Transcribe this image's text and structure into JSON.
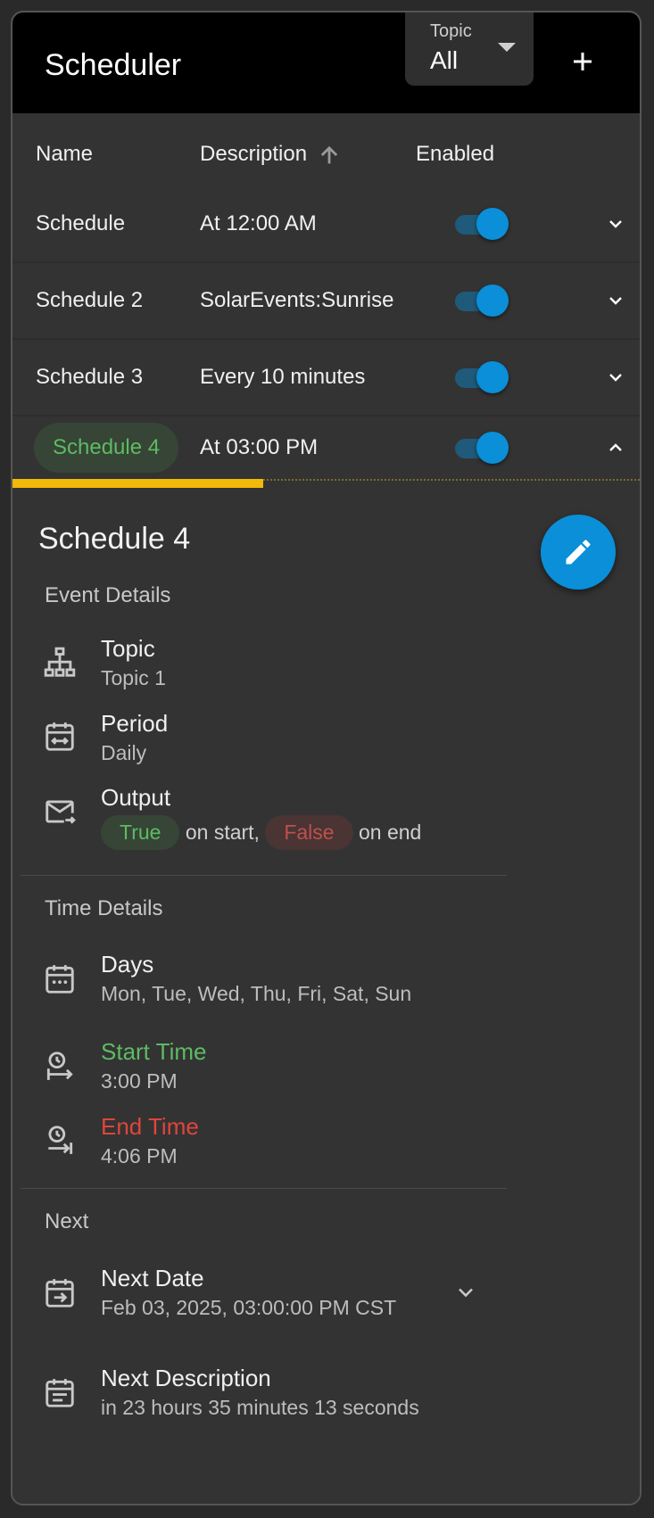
{
  "header": {
    "title": "Scheduler",
    "topic_label": "Topic",
    "topic_value": "All",
    "add_label": "+"
  },
  "table": {
    "columns": [
      "Name",
      "Description",
      "Enabled"
    ],
    "rows": [
      {
        "name": "Schedule",
        "description": "At 12:00 AM",
        "enabled": true
      },
      {
        "name": "Schedule 2",
        "description": "SolarEvents:Sunrise",
        "enabled": true
      },
      {
        "name": "Schedule 3",
        "description": "Every 10 minutes",
        "enabled": true
      },
      {
        "name": "Schedule 4",
        "description": "At 03:00 PM",
        "enabled": true
      }
    ]
  },
  "detail": {
    "title": "Schedule 4",
    "progress": 0.4,
    "event_section": "Event Details",
    "topic_label": "Topic",
    "topic_value": "Topic 1",
    "period_label": "Period",
    "period_value": "Daily",
    "output_label": "Output",
    "output_true": "True",
    "output_start": "on start,",
    "output_false": "False",
    "output_end": "on end",
    "time_section": "Time Details",
    "days_label": "Days",
    "days_value": "Mon, Tue, Wed, Thu, Fri, Sat, Sun",
    "start_label": "Start Time",
    "start_value": "3:00 PM",
    "end_label": "End Time",
    "end_value": "4:06 PM",
    "next_section": "Next",
    "next_date_label": "Next Date",
    "next_date_value": "Feb 03, 2025, 03:00:00 PM CST",
    "next_desc_label": "Next Description",
    "next_desc_value": "in 23 hours 35 minutes 13 seconds"
  },
  "colors": {
    "accent": "#0a8fd8",
    "progress": "#f1b90a",
    "true_green": "#5dbb63",
    "false_red": "#e0453a"
  }
}
